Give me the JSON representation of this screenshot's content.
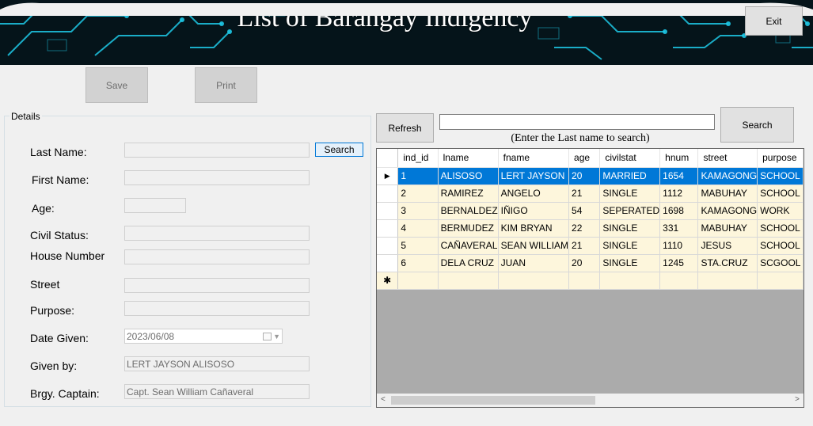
{
  "window": {
    "title": "List of Barangay Indigency",
    "exit_label": "Exit"
  },
  "toolbar": {
    "save_label": "Save",
    "print_label": "Print"
  },
  "details": {
    "group_label": "Details",
    "search_label": "Search",
    "fields": {
      "last_name": {
        "label": "Last Name:",
        "value": ""
      },
      "first_name": {
        "label": "First Name:",
        "value": ""
      },
      "age": {
        "label": "Age:",
        "value": ""
      },
      "civil_status": {
        "label": "Civil Status:",
        "value": ""
      },
      "house_number": {
        "label": "House Number",
        "value": ""
      },
      "street": {
        "label": "Street",
        "value": ""
      },
      "purpose": {
        "label": "Purpose:",
        "value": ""
      },
      "date_given": {
        "label": "Date Given:",
        "value": "2023/06/08"
      },
      "given_by": {
        "label": "Given by:",
        "value": "LERT JAYSON ALISOSO"
      },
      "captain": {
        "label": "Brgy. Captain:",
        "value": "Capt. Sean William Cañaveral"
      }
    }
  },
  "records": {
    "refresh_label": "Refresh",
    "search_label": "Search",
    "search_value": "",
    "hint": "(Enter the Last name to search)",
    "columns": [
      "ind_id",
      "lname",
      "fname",
      "age",
      "civilstat",
      "hnum",
      "street",
      "purpose"
    ],
    "rows": [
      [
        "1",
        "ALISOSO",
        "LERT JAYSON",
        "20",
        "MARRIED",
        "1654",
        "KAMAGONG",
        "SCHOOL"
      ],
      [
        "2",
        "RAMIREZ",
        "ANGELO",
        "21",
        "SINGLE",
        "1112",
        "MABUHAY",
        "SCHOOL"
      ],
      [
        "3",
        "BERNALDEZ",
        "IÑIGO",
        "54",
        "SEPERATED",
        "1698",
        "KAMAGONG",
        "WORK"
      ],
      [
        "4",
        "BERMUDEZ",
        "KIM BRYAN",
        "22",
        "SINGLE",
        "331",
        "MABUHAY",
        "SCHOOL"
      ],
      [
        "5",
        "CAÑAVERAL",
        "SEAN WILLIAM",
        "21",
        "SINGLE",
        "1110",
        "JESUS",
        "SCHOOL"
      ],
      [
        "6",
        "DELA CRUZ",
        "JUAN",
        "20",
        "SINGLE",
        "1245",
        "STA.CRUZ",
        "SCGOOL"
      ]
    ],
    "selected_row": 0,
    "current_row_marker": "▶",
    "new_row_marker": "✱"
  },
  "colors": {
    "accent": "#0078d7",
    "row_background": "#fdf6dc",
    "grid_background": "#ababab",
    "banner_glow": "#1ec8e6"
  }
}
